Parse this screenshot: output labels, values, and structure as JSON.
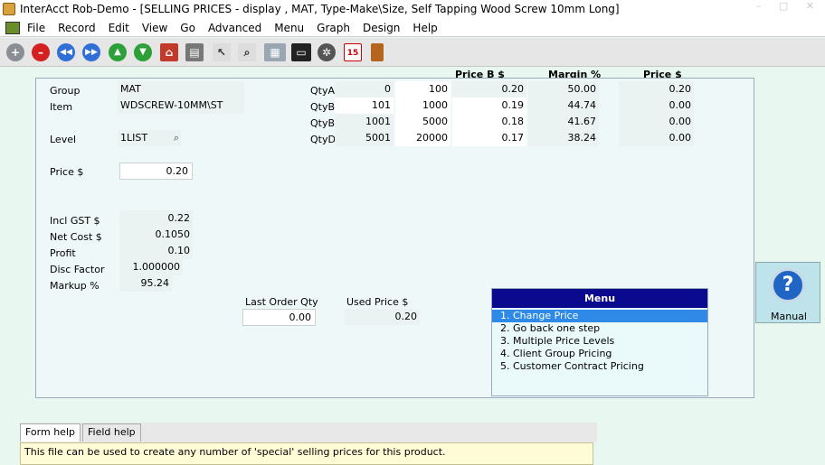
{
  "window": {
    "title": "InterAcct Rob-Demo - [SELLING PRICES - display , MAT, Type-Make\\Size, Self Tapping Wood Screw 10mm Long]"
  },
  "menubar": [
    "File",
    "Record",
    "Edit",
    "View",
    "Go",
    "Advanced",
    "Menu",
    "Graph",
    "Design",
    "Help"
  ],
  "toolbar": {
    "icons": [
      "add-icon",
      "delete-icon",
      "first-record-icon",
      "last-record-icon",
      "previous-up-icon",
      "next-down-icon",
      "home-icon",
      "print-icon",
      "pointer-icon",
      "search-icon",
      "keyboard-icon",
      "monitor-icon",
      "settings-icon",
      "calendar-icon",
      "exit-door-icon"
    ],
    "calendar_day": "15"
  },
  "left": {
    "group_label": "Group",
    "group_value": "MAT",
    "item_label": "Item",
    "item_value": "WDSCREW-10MM\\ST",
    "level_label": "Level",
    "level_value": "1LIST",
    "price_label": "Price  $",
    "price_value": "0.20",
    "incl_gst_label": "Incl GST $",
    "incl_gst_value": "0.22",
    "net_cost_label": "Net Cost $",
    "net_cost_value": "0.1050",
    "profit_label": "Profit",
    "profit_value": "0.10",
    "disc_factor_label": "Disc Factor",
    "disc_factor_value": "1.000000",
    "markup_label": "Markup %",
    "markup_value": "95.24"
  },
  "qty_table": {
    "headers": {
      "price_b": "Price B $",
      "margin": "Margin %",
      "price": "Price  $"
    },
    "rows": [
      {
        "label": "QtyA",
        "from": "0",
        "to": "100",
        "price_b": "0.20",
        "margin": "50.00",
        "price": "0.20"
      },
      {
        "label": "QtyB",
        "from": "101",
        "to": "1000",
        "price_b": "0.19",
        "margin": "44.74",
        "price": "0.00"
      },
      {
        "label": "QtyB",
        "from": "1001",
        "to": "5000",
        "price_b": "0.18",
        "margin": "41.67",
        "price": "0.00"
      },
      {
        "label": "QtyD",
        "from": "5001",
        "to": "20000",
        "price_b": "0.17",
        "margin": "38.24",
        "price": "0.00"
      }
    ]
  },
  "order": {
    "last_order_qty_label": "Last Order Qty",
    "last_order_qty_value": "0.00",
    "used_price_label": "Used Price  $",
    "used_price_value": "0.20"
  },
  "menu": {
    "title": "Menu",
    "items": [
      "1. Change Price",
      "2. Go back one step",
      "3. Multiple Price Levels",
      "4. Client Group Pricing",
      "5. Customer Contract Pricing"
    ],
    "selected_index": 0
  },
  "help_button": {
    "label": "Manual"
  },
  "help_tabs": [
    "Form help",
    "Field help"
  ],
  "help_text": "This file can be used to create any number of 'special' selling prices for this product."
}
